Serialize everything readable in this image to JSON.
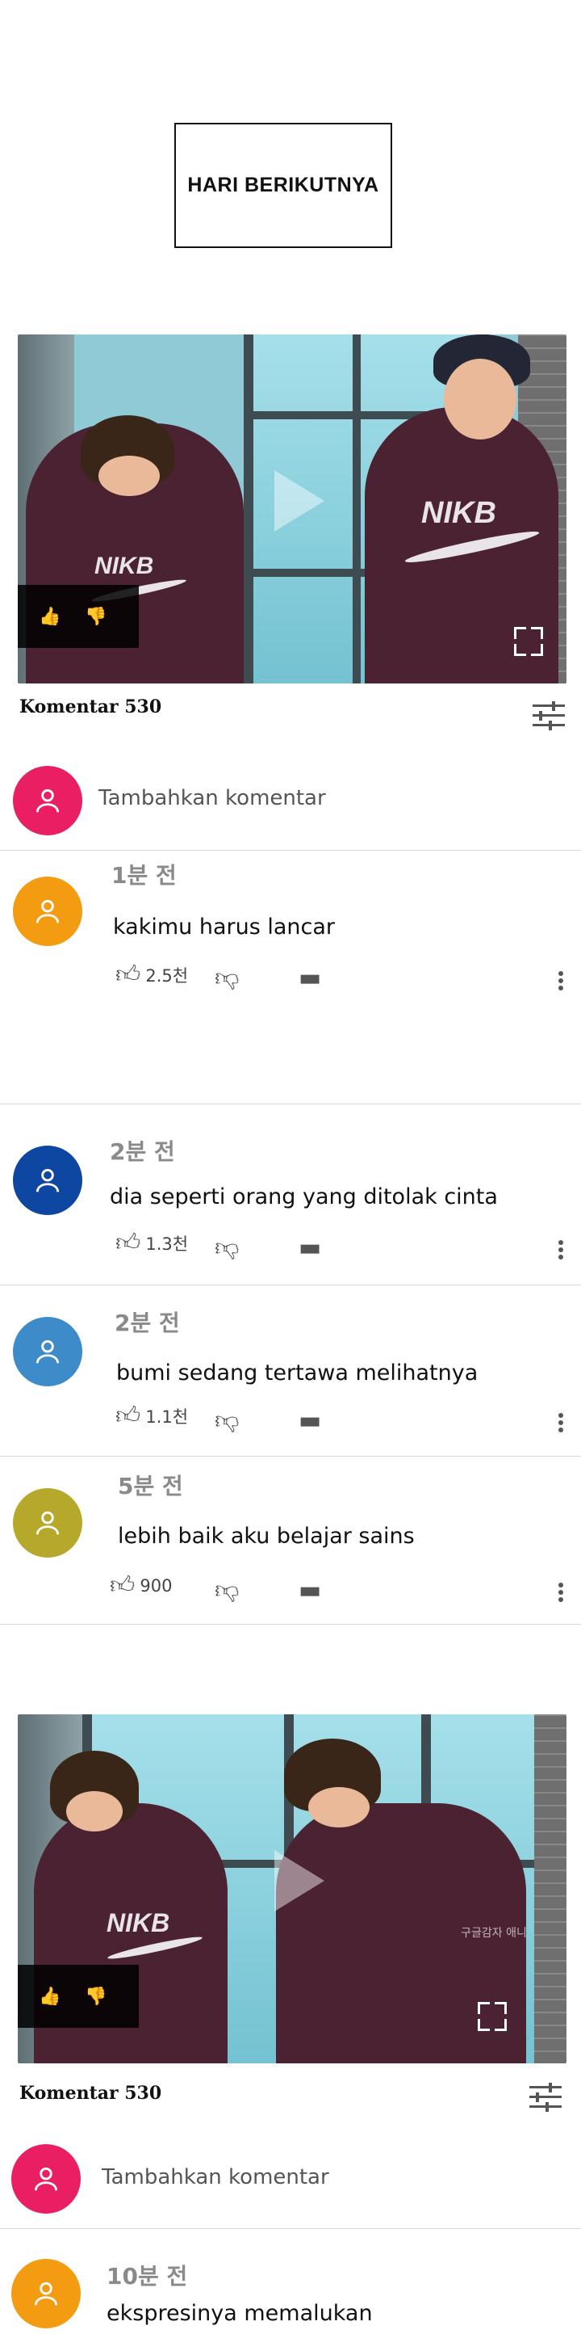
{
  "caption": "HARI BERIKUTNYA",
  "sections": [
    {
      "komentar_label": "Komentar 530",
      "add_comment": "Tambahkan komentar",
      "comments": [
        {
          "time": "1분 전",
          "text": "kakimu harus lancar",
          "likes": "2.5천",
          "avatar_color": "#f39c12"
        },
        {
          "time": "2분 전",
          "text": "dia seperti orang yang ditolak cinta",
          "likes": "1.3천",
          "avatar_color": "#0d47a1"
        },
        {
          "time": "2분 전",
          "text": "bumi sedang tertawa melihatnya",
          "likes": "1.1천",
          "avatar_color": "#3d8bc9"
        },
        {
          "time": "5분 전",
          "text": "lebih baik aku belajar sains",
          "likes": "900",
          "avatar_color": "#b5a82a"
        }
      ]
    },
    {
      "komentar_label": "Komentar 530",
      "add_comment": "Tambahkan komentar",
      "comments": [
        {
          "time": "10분 전",
          "text": "ekspresinya memalukan",
          "avatar_color": "#f39c12"
        }
      ]
    }
  ],
  "watermark": "구글감자 애니",
  "colors": {
    "add_avatar": "#e91e63",
    "video_bg": "#8fcad6",
    "hoodie": "#4b2232"
  },
  "icons": {
    "like": "thumb-up-icon",
    "dislike": "thumb-down-icon",
    "reply": "comment-icon",
    "more": "more-vert-icon",
    "filter": "tune-icon",
    "user": "user-icon",
    "play": "play-icon",
    "fullscreen": "fullscreen-icon"
  }
}
